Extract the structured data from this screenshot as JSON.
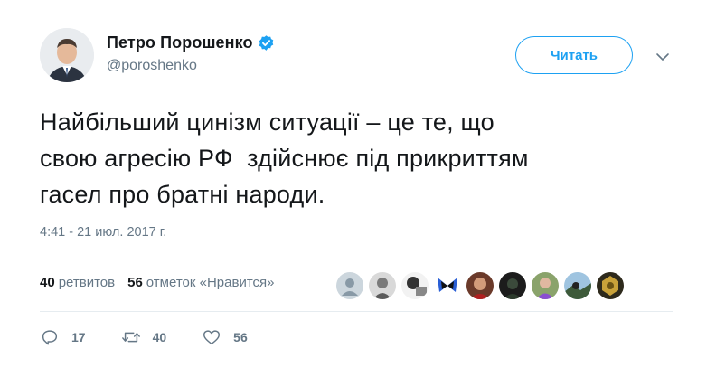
{
  "author": {
    "name": "Петро Порошенко",
    "handle": "@poroshenko",
    "verified": true
  },
  "follow_button": {
    "label": "Читать"
  },
  "tweet": {
    "text": "Найбільший цинізм ситуації – це те, що\nсвою агресію РФ  здійснює під прикриттям\nгасел про братні народи.",
    "timestamp": "4:41 - 21 июл. 2017 г."
  },
  "stats": {
    "retweets_count": "40",
    "retweets_label": "ретвитов",
    "likes_count": "56",
    "likes_label": "отметок «Нравится»"
  },
  "liked_by": [
    {
      "icon": "default-avatar"
    },
    {
      "icon": "user-avatar-gray"
    },
    {
      "icon": "user-avatar-bw"
    },
    {
      "icon": "butterfly-avatar"
    },
    {
      "icon": "user-avatar-red"
    },
    {
      "icon": "user-avatar-dark"
    },
    {
      "icon": "user-avatar-purple"
    },
    {
      "icon": "user-avatar-landscape"
    },
    {
      "icon": "user-avatar-gold"
    }
  ],
  "actions": {
    "reply_count": "17",
    "retweet_count": "40",
    "like_count": "56"
  },
  "colors": {
    "accent": "#1da1f2",
    "text": "#14171a",
    "secondary_text": "#657786",
    "divider": "#e6ecf0"
  }
}
